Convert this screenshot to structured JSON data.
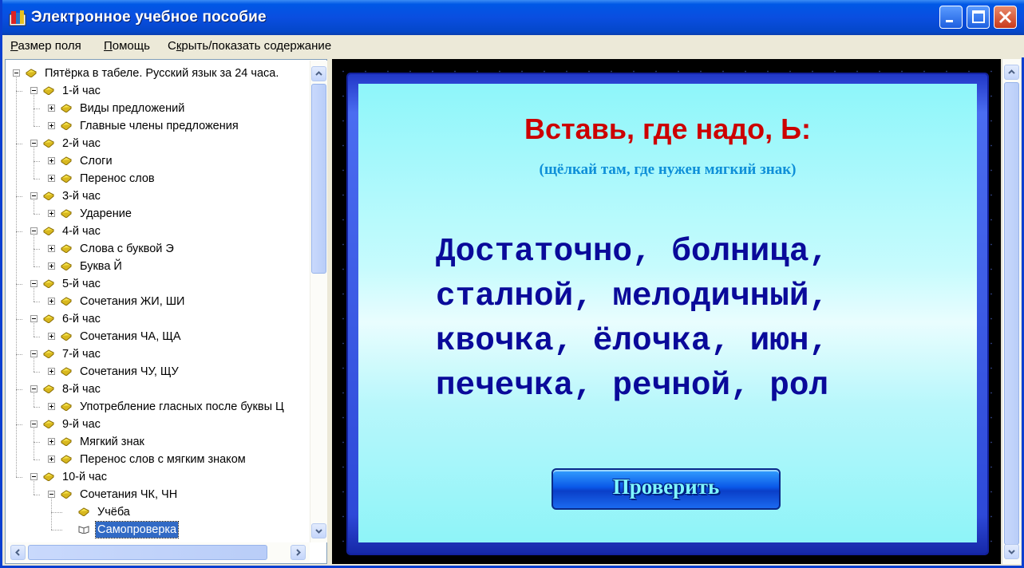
{
  "window": {
    "title": "Электронное учебное пособие",
    "app_icon": "tutorial-app-icon",
    "controls": [
      "minimize-icon",
      "maximize-icon",
      "close-icon"
    ]
  },
  "menu": {
    "items": [
      {
        "label": "Размер поля",
        "accesskey": "Р"
      },
      {
        "label": "Помощь",
        "accesskey": "П"
      },
      {
        "label": "Скрыть/показать содержание",
        "accesskey": "к"
      }
    ]
  },
  "tree": {
    "items": [
      {
        "label": "Пятёрка в табеле. Русский язык за 24 часа.",
        "level": 0,
        "expander": "minus",
        "icon": "closed-book-icon"
      },
      {
        "label": "1-й час",
        "level": 1,
        "expander": "minus",
        "icon": "closed-book-icon"
      },
      {
        "label": "Виды предложений",
        "level": 2,
        "expander": "plus",
        "icon": "closed-book-icon"
      },
      {
        "label": "Главные члены предложения",
        "level": 2,
        "expander": "plus",
        "icon": "closed-book-icon"
      },
      {
        "label": "2-й час",
        "level": 1,
        "expander": "minus",
        "icon": "closed-book-icon"
      },
      {
        "label": "Слоги",
        "level": 2,
        "expander": "plus",
        "icon": "closed-book-icon"
      },
      {
        "label": "Перенос слов",
        "level": 2,
        "expander": "plus",
        "icon": "closed-book-icon"
      },
      {
        "label": "3-й час",
        "level": 1,
        "expander": "minus",
        "icon": "closed-book-icon"
      },
      {
        "label": "Ударение",
        "level": 2,
        "expander": "plus",
        "icon": "closed-book-icon"
      },
      {
        "label": "4-й час",
        "level": 1,
        "expander": "minus",
        "icon": "closed-book-icon"
      },
      {
        "label": "Слова с буквой Э",
        "level": 2,
        "expander": "plus",
        "icon": "closed-book-icon"
      },
      {
        "label": "Буква Й",
        "level": 2,
        "expander": "plus",
        "icon": "closed-book-icon"
      },
      {
        "label": "5-й час",
        "level": 1,
        "expander": "minus",
        "icon": "closed-book-icon"
      },
      {
        "label": "Сочетания ЖИ, ШИ",
        "level": 2,
        "expander": "plus",
        "icon": "closed-book-icon"
      },
      {
        "label": "6-й час",
        "level": 1,
        "expander": "minus",
        "icon": "closed-book-icon"
      },
      {
        "label": "Сочетания ЧА, ЩА",
        "level": 2,
        "expander": "plus",
        "icon": "closed-book-icon"
      },
      {
        "label": "7-й час",
        "level": 1,
        "expander": "minus",
        "icon": "closed-book-icon"
      },
      {
        "label": "Сочетания ЧУ, ЩУ",
        "level": 2,
        "expander": "plus",
        "icon": "closed-book-icon"
      },
      {
        "label": "8-й час",
        "level": 1,
        "expander": "minus",
        "icon": "closed-book-icon"
      },
      {
        "label": "Употребление гласных после буквы Ц",
        "level": 2,
        "expander": "plus",
        "icon": "closed-book-icon"
      },
      {
        "label": "9-й час",
        "level": 1,
        "expander": "minus",
        "icon": "closed-book-icon"
      },
      {
        "label": "Мягкий знак",
        "level": 2,
        "expander": "plus",
        "icon": "closed-book-icon"
      },
      {
        "label": "Перенос слов с мягким знаком",
        "level": 2,
        "expander": "plus",
        "icon": "closed-book-icon"
      },
      {
        "label": "10-й час",
        "level": 1,
        "expander": "minus",
        "icon": "closed-book-icon"
      },
      {
        "label": "Сочетания ЧК, ЧН",
        "level": 2,
        "expander": "minus",
        "icon": "closed-book-icon"
      },
      {
        "label": "Учёба",
        "level": 3,
        "expander": "none",
        "icon": "closed-book-icon"
      },
      {
        "label": "Самопроверка",
        "level": 3,
        "expander": "none",
        "icon": "open-book-icon",
        "selected": true
      }
    ]
  },
  "exercise": {
    "title": "Вставь, где надо, Ь:",
    "hint": "(щёлкай там, где нужен мягкий знак)",
    "lines": [
      "Достаточно, болница,",
      "сталной, мелодичный,",
      "квочка, ёлочка, июн,",
      "печечка, речной, рол"
    ],
    "check_button": "Проверить"
  },
  "colors": {
    "title_bar": "#0a4ee0",
    "exercise_title": "#cc0000",
    "exercise_hint": "#0e8fd8",
    "exercise_words": "#0a0a9a",
    "selection": "#316ac5"
  }
}
